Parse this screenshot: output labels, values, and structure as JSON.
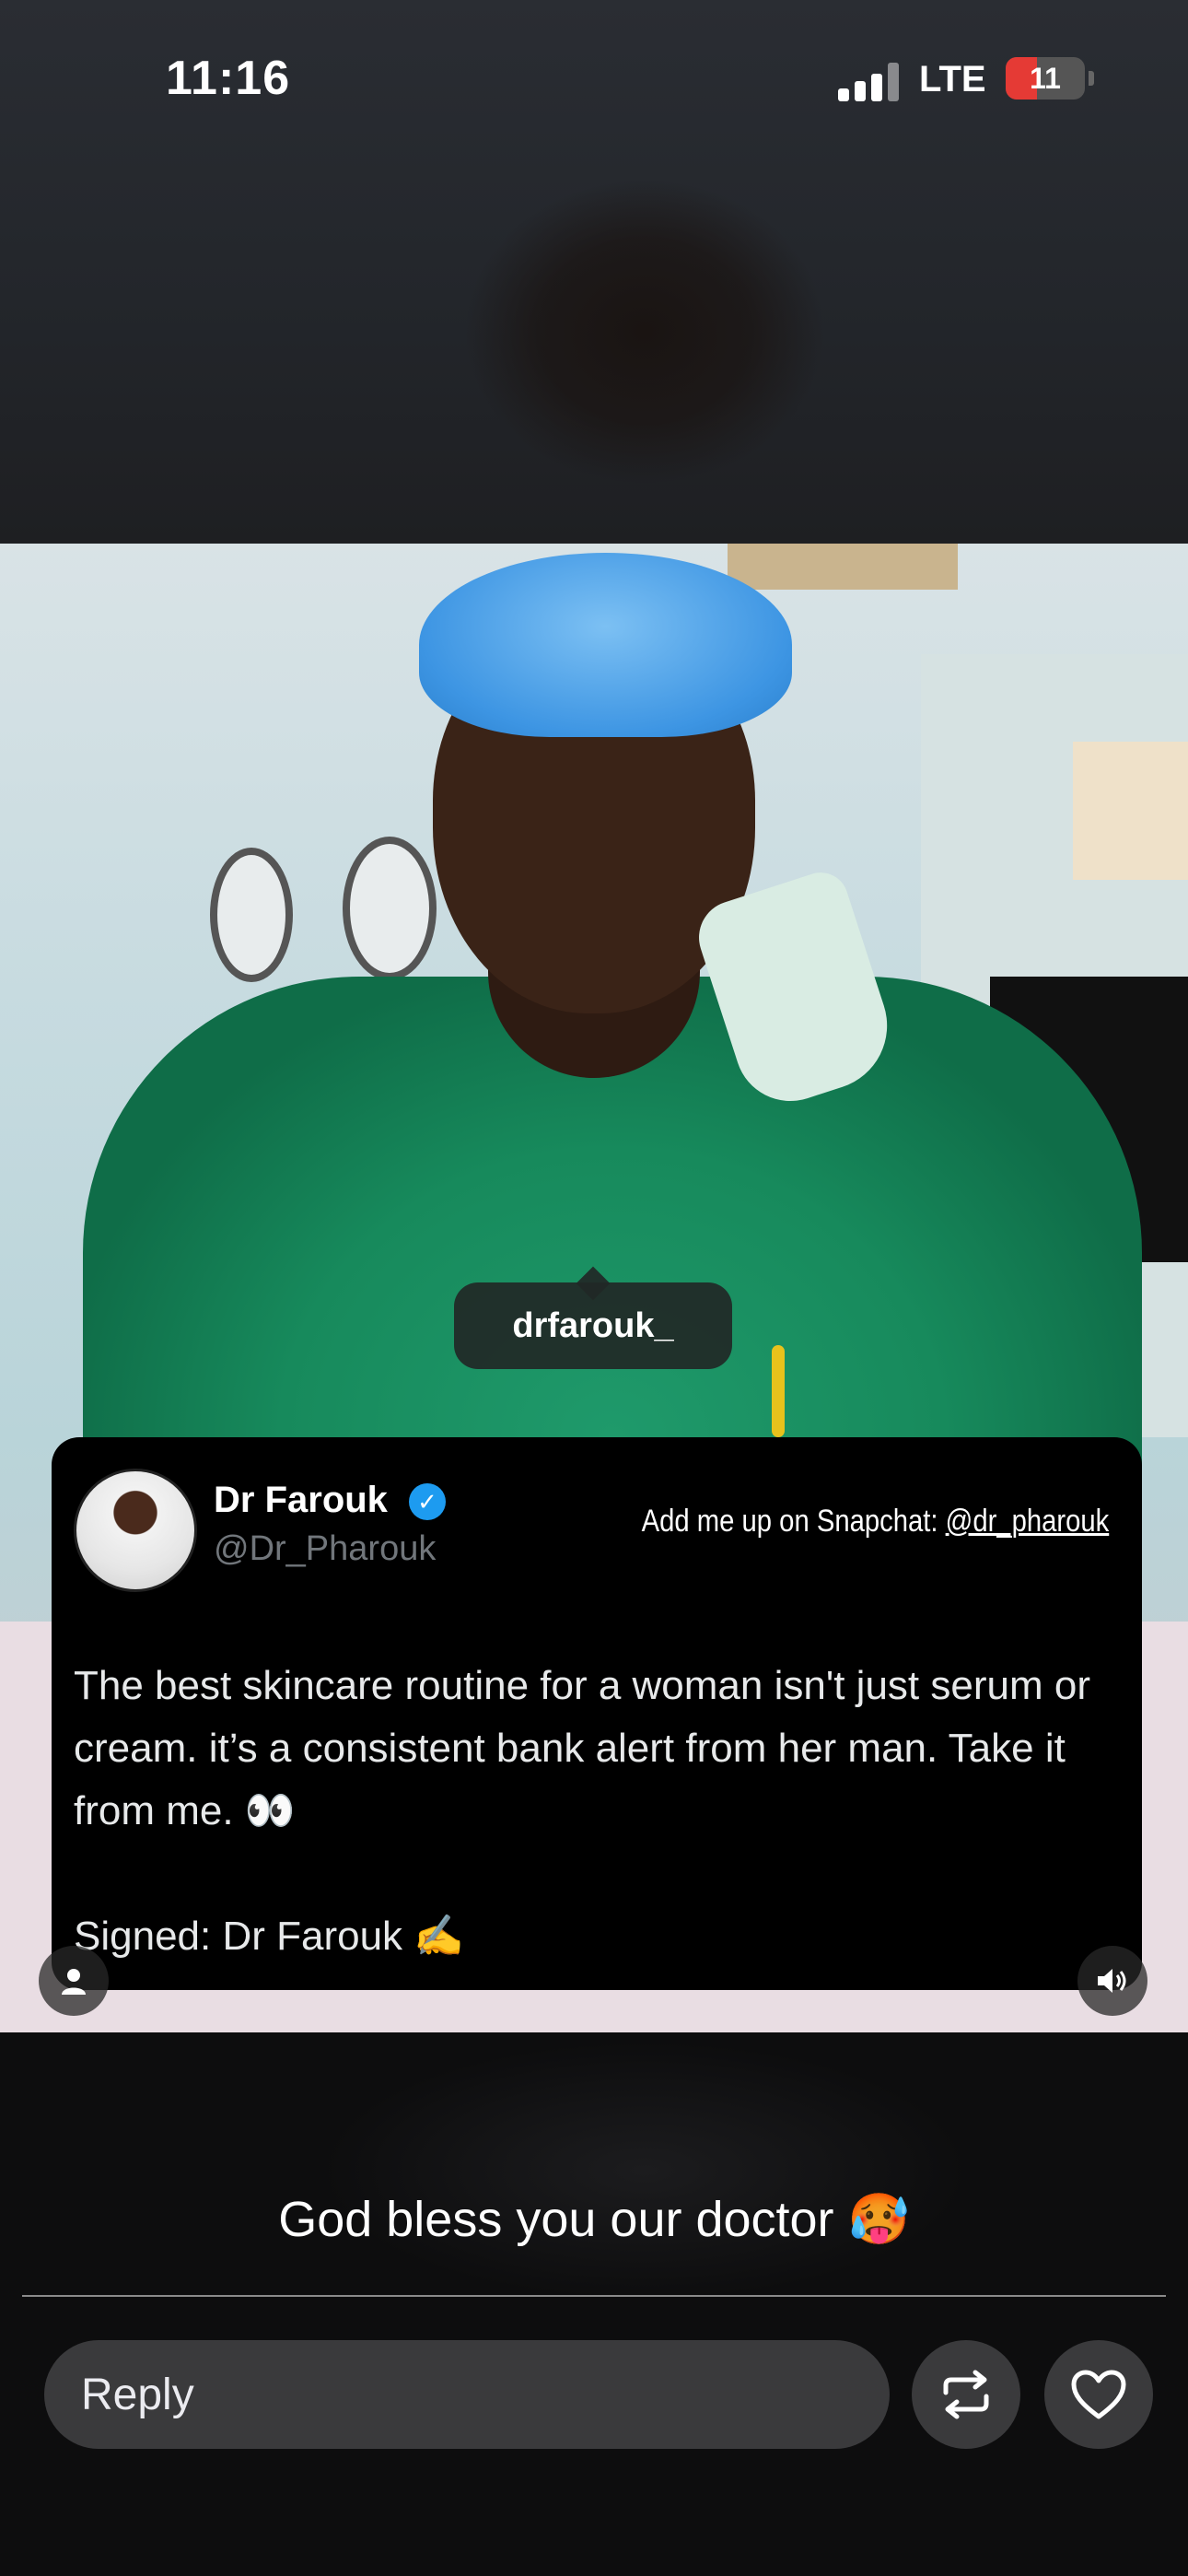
{
  "status_bar": {
    "time": "11:16",
    "network": "LTE",
    "battery": "11",
    "battery_level_percent": 11,
    "battery_color": "#e53a35"
  },
  "story": {
    "mention_tag": "drfarouk_",
    "caption": "God bless you our doctor 🥵",
    "profile_icon": "person-icon",
    "sound_icon": "speaker-icon"
  },
  "tweet": {
    "author_name": "Dr Farouk",
    "verified_mark": "✓",
    "handle": "@Dr_Pharouk",
    "snapchat_prefix": "Add me up on Snapchat: ",
    "snapchat_handle": "@dr_pharouk",
    "text": "The best skincare routine for a woman isn't just serum or cream. it’s a consistent bank alert from her man. Take it from me. 👀\n\nSigned: Dr Farouk ✍️",
    "verified_color": "#1d9bf0"
  },
  "reply_bar": {
    "placeholder": "Reply",
    "repost_icon": "repost-icon",
    "like_icon": "heart-icon"
  }
}
